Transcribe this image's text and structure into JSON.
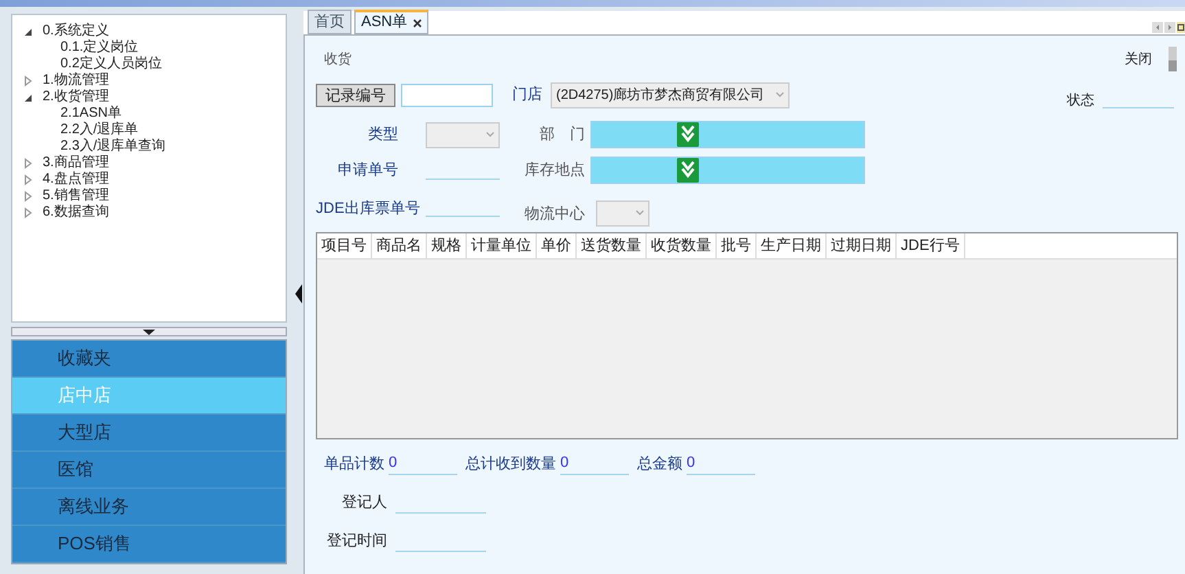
{
  "tree": [
    {
      "label": "0.系统定义",
      "expanded": true,
      "children": [
        {
          "label": "0.1.定义岗位"
        },
        {
          "label": "0.2定义人员岗位"
        }
      ]
    },
    {
      "label": "1.物流管理",
      "expanded": false
    },
    {
      "label": "2.收货管理",
      "expanded": true,
      "children": [
        {
          "label": "2.1ASN单"
        },
        {
          "label": "2.2入/退库单"
        },
        {
          "label": "2.3入/退库单查询"
        }
      ]
    },
    {
      "label": "3.商品管理",
      "expanded": false
    },
    {
      "label": "4.盘点管理",
      "expanded": false
    },
    {
      "label": "5.销售管理",
      "expanded": false
    },
    {
      "label": "6.数据查询",
      "expanded": false
    }
  ],
  "nav": [
    {
      "label": "收藏夹",
      "selected": false
    },
    {
      "label": "店中店",
      "selected": true
    },
    {
      "label": "大型店",
      "selected": false
    },
    {
      "label": "医馆",
      "selected": false
    },
    {
      "label": "离线业务",
      "selected": false
    },
    {
      "label": "POS销售",
      "selected": false
    }
  ],
  "tabs": [
    {
      "label": "首页",
      "selected": false,
      "closable": false
    },
    {
      "label": "ASN单",
      "selected": true,
      "closable": true
    }
  ],
  "form": {
    "section": "收货",
    "close_label": "关闭",
    "record_button": "记录编号",
    "store_label": "门店",
    "store_value": "(2D4275)廊坊市梦杰商贸有限公司",
    "status_label": "状态",
    "type_label": "类型",
    "dept_label": "部　门",
    "request_label": "申请单号",
    "location_label": "库存地点",
    "jde_label": "JDE出库票单号",
    "logistics_label": "物流中心"
  },
  "table": {
    "columns": [
      "项目号",
      "商品名",
      "规格",
      "计量单位",
      "单价",
      "送货数量",
      "收货数量",
      "批号",
      "生产日期",
      "过期日期",
      "JDE行号"
    ]
  },
  "totals": [
    {
      "label": "单品计数",
      "value": "0"
    },
    {
      "label": "总计收到数量",
      "value": "0"
    },
    {
      "label": "总金额",
      "value": "0"
    }
  ],
  "footer": [
    {
      "label": "登记人"
    },
    {
      "label": "登记时间"
    }
  ]
}
